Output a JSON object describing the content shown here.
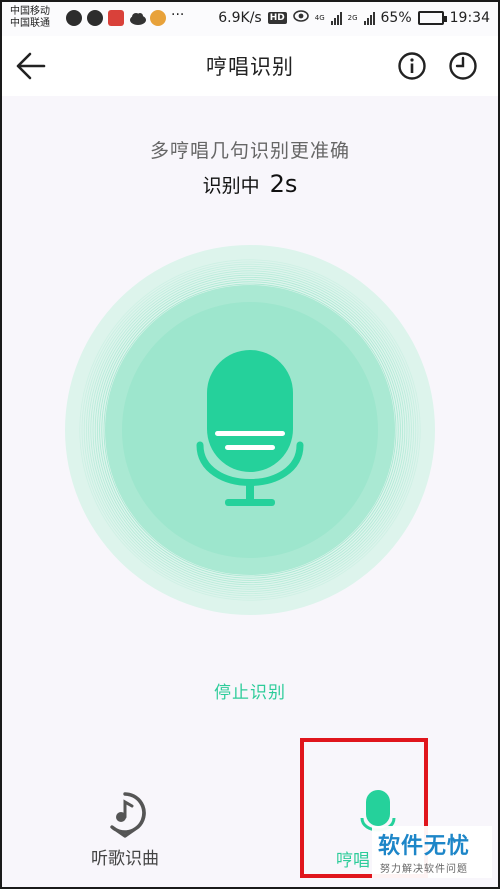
{
  "status_bar": {
    "carrier_1": "中国移动",
    "carrier_2": "中国联通",
    "speed": "6.9K/s",
    "hd": "HD",
    "net_1": "4G",
    "net_2": "2G",
    "battery": "65%",
    "battery_level": 0.65,
    "time": "19:34"
  },
  "header": {
    "title": "哼唱识别"
  },
  "main": {
    "hint": "多哼唱几句识别更准确",
    "status_label": "识别中",
    "status_seconds": "2s",
    "stop_label": "停止识别"
  },
  "tabs": {
    "song": "听歌识曲",
    "hum": "哼唱"
  },
  "watermark": {
    "main": "软件无忧",
    "sub": "努力解决软件问题"
  },
  "colors": {
    "accent": "#2ecc9a",
    "mic_green": "#25d19b",
    "outer_circle": "#ddf4ec",
    "inner_circle": "#7fe0bf",
    "highlight_box": "#e0151c"
  }
}
